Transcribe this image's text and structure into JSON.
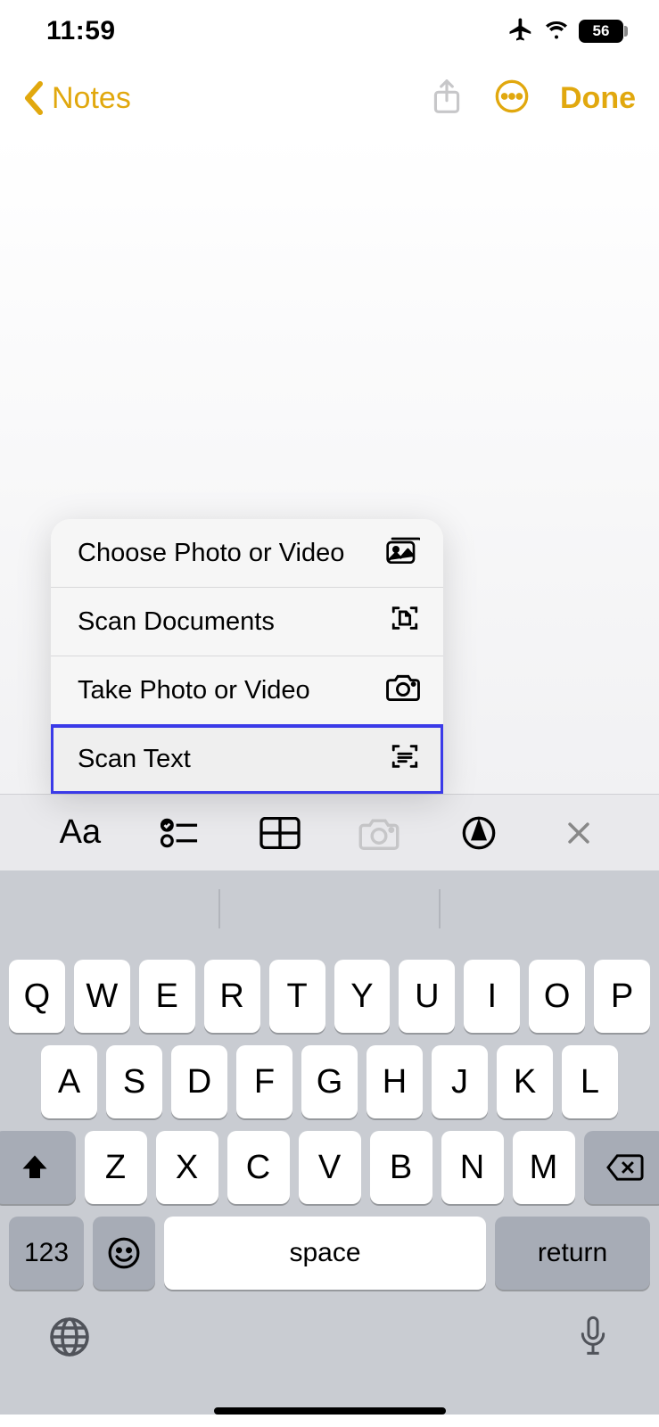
{
  "status": {
    "time": "11:59",
    "battery": "56"
  },
  "nav": {
    "back": "Notes",
    "done": "Done"
  },
  "popup": {
    "items": [
      {
        "label": "Choose Photo or Video"
      },
      {
        "label": "Scan Documents"
      },
      {
        "label": "Take Photo or Video"
      },
      {
        "label": "Scan Text"
      }
    ]
  },
  "toolbar": {
    "aa": "Aa"
  },
  "keyboard": {
    "row1": [
      "Q",
      "W",
      "E",
      "R",
      "T",
      "Y",
      "U",
      "I",
      "O",
      "P"
    ],
    "row2": [
      "A",
      "S",
      "D",
      "F",
      "G",
      "H",
      "J",
      "K",
      "L"
    ],
    "row3": [
      "Z",
      "X",
      "C",
      "V",
      "B",
      "N",
      "M"
    ],
    "numKey": "123",
    "space": "space",
    "return": "return"
  }
}
